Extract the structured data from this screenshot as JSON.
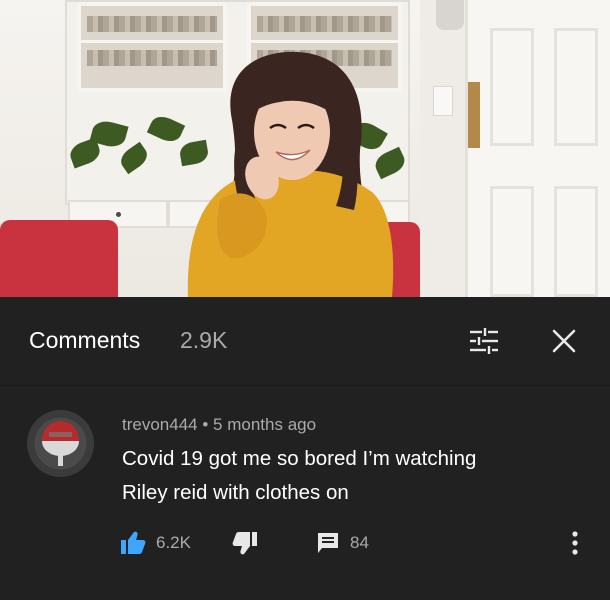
{
  "video": {
    "description_icon": "video-frame"
  },
  "comments": {
    "title": "Comments",
    "count": "2.9K",
    "filter_icon": "sort-filter-icon",
    "close_icon": "close-icon"
  },
  "comment": {
    "author": "trevon444",
    "separator": "•",
    "time": "5 months ago",
    "text_line1": "Covid 19 got me so bored I’m watching",
    "text_line2": "Riley reid with clothes on",
    "likes": "6.2K",
    "replies": "84",
    "like_icon": "thumbs-up-icon",
    "dislike_icon": "thumbs-down-icon",
    "reply_icon": "reply-comment-icon",
    "menu_icon": "more-vert-icon"
  },
  "colors": {
    "background": "#212121",
    "primary_text": "#ffffff",
    "secondary_text": "#aaaaaa",
    "like_active": "#3ea6ff"
  }
}
